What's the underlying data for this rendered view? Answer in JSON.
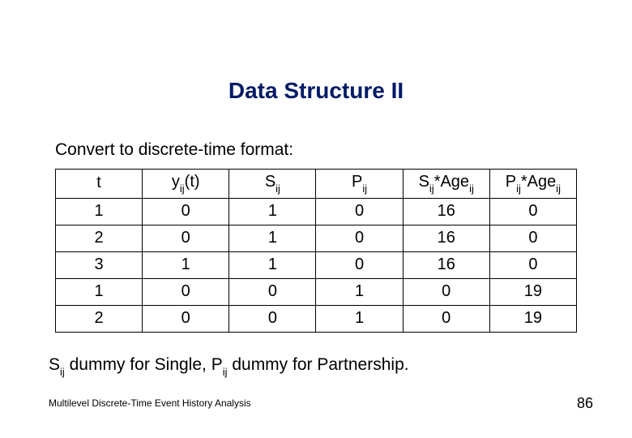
{
  "title": "Data Structure II",
  "subtitle": "Convert to discrete-time format:",
  "table": {
    "headers": {
      "t": "t",
      "y_main": "y",
      "y_sub": "ij",
      "y_suffix": "(t)",
      "s_main": "S",
      "s_sub": "ij",
      "p_main": "P",
      "p_sub": "ij",
      "sage_main1": "S",
      "sage_sub1": "ij",
      "sage_mid": "*Age",
      "sage_sub2": "ij",
      "page_main1": "P",
      "page_sub1": "ij",
      "page_mid": "*Age",
      "page_sub2": "ij"
    },
    "rows": [
      {
        "t": "1",
        "y": "0",
        "s": "1",
        "p": "0",
        "sage": "16",
        "page": "0"
      },
      {
        "t": "2",
        "y": "0",
        "s": "1",
        "p": "0",
        "sage": "16",
        "page": "0"
      },
      {
        "t": "3",
        "y": "1",
        "s": "1",
        "p": "0",
        "sage": "16",
        "page": "0"
      },
      {
        "t": "1",
        "y": "0",
        "s": "0",
        "p": "1",
        "sage": "0",
        "page": "19"
      },
      {
        "t": "2",
        "y": "0",
        "s": "0",
        "p": "1",
        "sage": "0",
        "page": "19"
      }
    ]
  },
  "note": {
    "s_main": "S",
    "s_sub": "ij",
    "mid1": " dummy for Single, ",
    "p_main": "P",
    "p_sub": "ij",
    "mid2": " dummy for Partnership."
  },
  "footer_left": "Multilevel Discrete-Time Event History Analysis",
  "footer_right": "86"
}
